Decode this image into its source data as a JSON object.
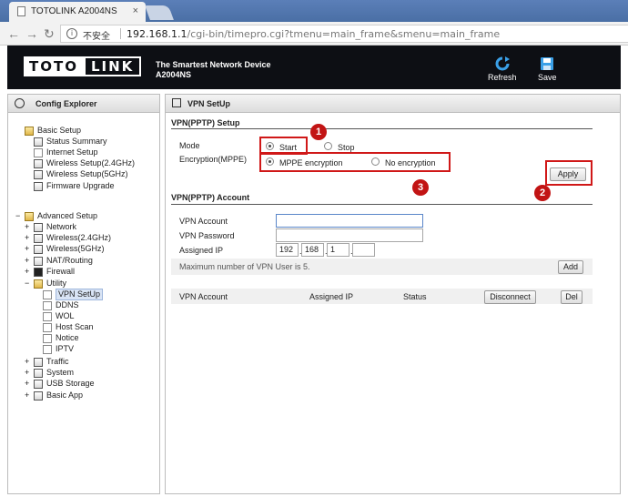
{
  "browser": {
    "tab_title": "TOTOLINK A2004NS",
    "tab_close": "×",
    "insecure_label": "不安全",
    "url_host": "192.168.1.1",
    "url_path": "/cgi-bin/timepro.cgi?tmenu=main_frame&smenu=main_frame"
  },
  "header": {
    "logo_left": "TOTO",
    "logo_right": "LINK",
    "tagline_line1": "The Smartest Network Device",
    "tagline_line2": "A2004NS",
    "refresh_label": "Refresh",
    "save_label": "Save"
  },
  "sidebar": {
    "title": "Config Explorer",
    "items": [
      {
        "label": "Basic Setup",
        "pm": ""
      },
      {
        "label": "Status Summary"
      },
      {
        "label": "Internet Setup"
      },
      {
        "label": "Wireless Setup(2.4GHz)"
      },
      {
        "label": "Wireless Setup(5GHz)"
      },
      {
        "label": "Firmware Upgrade"
      },
      {
        "label": "Advanced Setup",
        "pm": "−"
      },
      {
        "label": "Network",
        "pm": "+"
      },
      {
        "label": "Wireless(2.4GHz)",
        "pm": "+"
      },
      {
        "label": "Wireless(5GHz)",
        "pm": "+"
      },
      {
        "label": "NAT/Routing",
        "pm": "+"
      },
      {
        "label": "Firewall",
        "pm": "+"
      },
      {
        "label": "Utility",
        "pm": "−"
      },
      {
        "label": "VPN SetUp"
      },
      {
        "label": "DDNS"
      },
      {
        "label": "WOL"
      },
      {
        "label": "Host Scan"
      },
      {
        "label": "Notice"
      },
      {
        "label": "IPTV"
      },
      {
        "label": "Traffic",
        "pm": "+"
      },
      {
        "label": "System",
        "pm": "+"
      },
      {
        "label": "USB Storage",
        "pm": "+"
      },
      {
        "label": "Basic App",
        "pm": "+"
      }
    ]
  },
  "main": {
    "panel_title": "VPN SetUp",
    "setup_section": "VPN(PPTP) Setup",
    "mode_label": "Mode",
    "mode_start": "Start",
    "mode_stop": "Stop",
    "encryption_label": "Encryption(MPPE)",
    "enc_mppe": "MPPE encryption",
    "enc_none": "No encryption",
    "apply_label": "Apply",
    "account_section": "VPN(PPTP) Account",
    "vpn_account_label": "VPN Account",
    "vpn_password_label": "VPN Password",
    "assigned_ip_label": "Assigned IP",
    "ip_octets": [
      "192",
      "168",
      "1",
      ""
    ],
    "max_users_hint": "Maximum number of VPN User is 5.",
    "add_label": "Add",
    "table_headers": {
      "account": "VPN Account",
      "ip": "Assigned IP",
      "status": "Status"
    },
    "disconnect_label": "Disconnect",
    "del_label": "Del"
  },
  "annotations": {
    "b1": "1",
    "b2": "2",
    "b3": "3"
  },
  "colors": {
    "header_bg": "#0d0f14",
    "annotation_red": "#d01818",
    "selected_bg": "#d9e4f5"
  }
}
